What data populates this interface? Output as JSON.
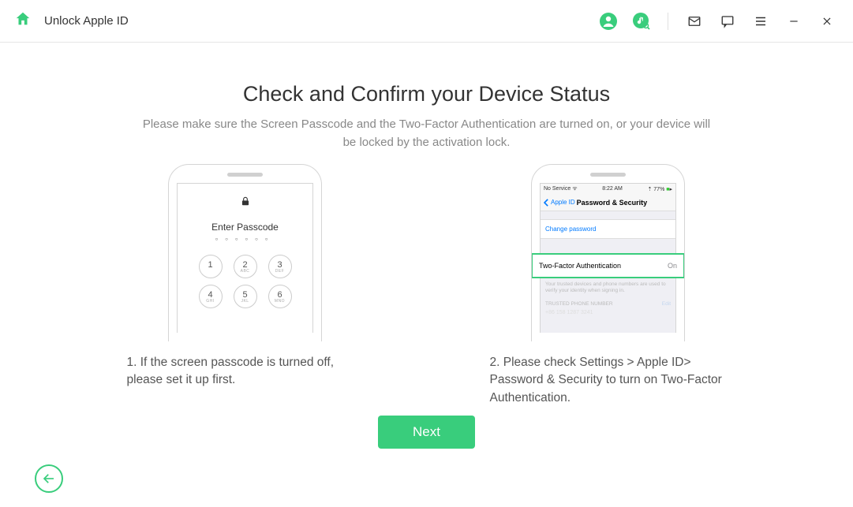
{
  "titlebar": {
    "app_title": "Unlock Apple ID"
  },
  "main": {
    "heading": "Check and Confirm your Device Status",
    "subtitle": "Please make sure the Screen Passcode and the Two-Factor Authentication are turned on, or your device will be locked by the activation lock."
  },
  "phone_passcode": {
    "enter_label": "Enter Passcode",
    "keys": {
      "k1": "1",
      "k2": "2",
      "k2s": "ABC",
      "k3": "3",
      "k3s": "DEF",
      "k4": "4",
      "k4s": "GHI",
      "k5": "5",
      "k5s": "JKL",
      "k6": "6",
      "k6s": "MNO"
    }
  },
  "phone_settings": {
    "statusbar_left": "No Service",
    "statusbar_time": "8:22 AM",
    "statusbar_right": "77%",
    "nav_back": "Apple ID",
    "nav_title": "Password & Security",
    "change_password": "Change password",
    "tfa_label": "Two-Factor Authentication",
    "tfa_value": "On",
    "tfa_hint": "Your trusted devices and phone numbers are used to verify your identity when signing in.",
    "trusted_header": "TRUSTED PHONE NUMBER",
    "trusted_edit": "Edit",
    "trusted_number": "+86 158 1287 3241"
  },
  "steps": {
    "step1": "1. If the screen passcode is turned off, please set it up first.",
    "step2": "2. Please check Settings > Apple ID> Password & Security to turn on Two-Factor Authentication."
  },
  "buttons": {
    "next": "Next"
  }
}
